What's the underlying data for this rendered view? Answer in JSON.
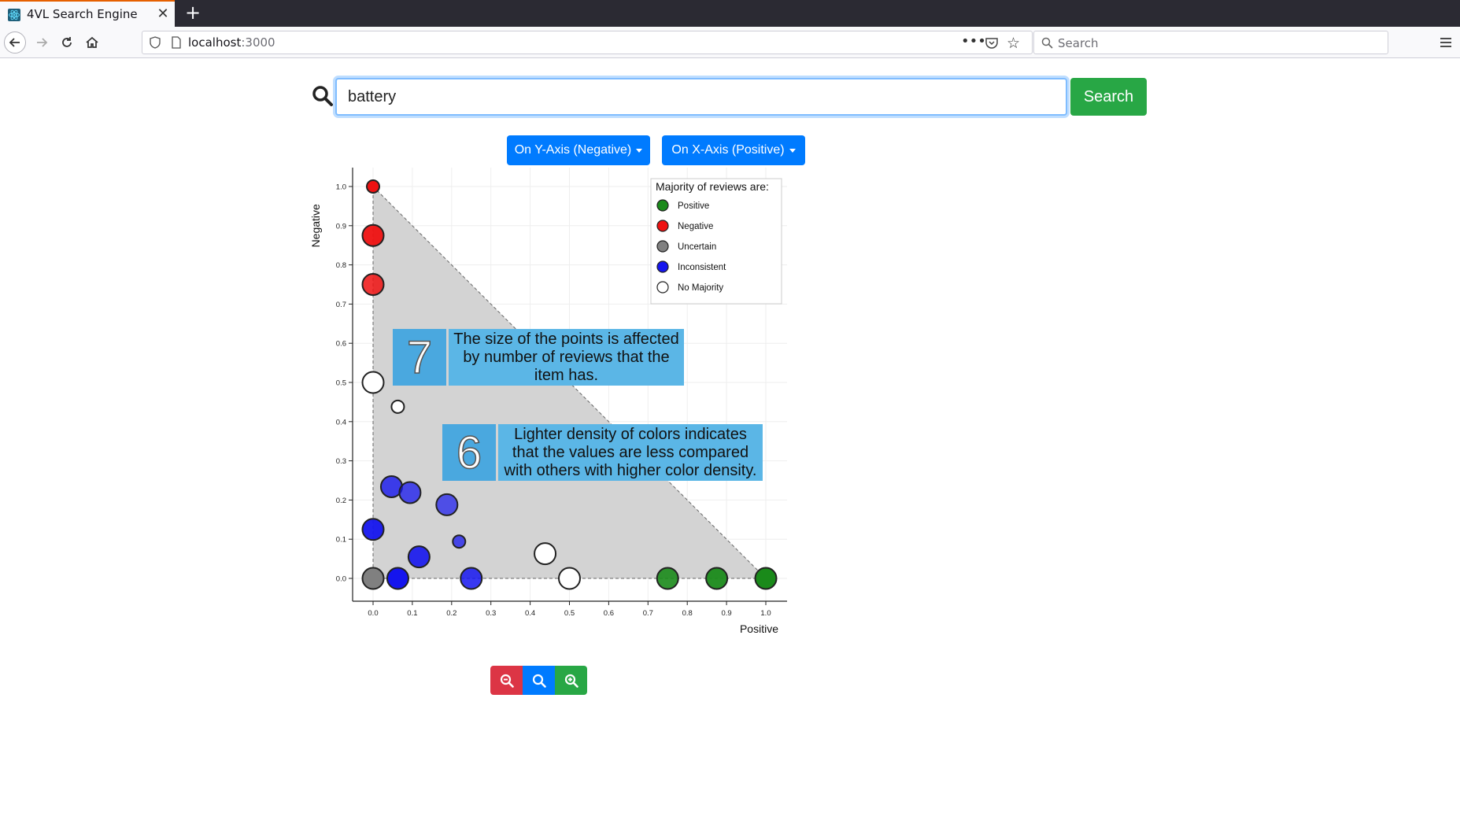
{
  "browser": {
    "tab_title": "4VL Search Engine",
    "url_host": "localhost",
    "url_port": ":3000",
    "search_placeholder": "Search"
  },
  "search": {
    "query": "battery",
    "button_label": "Search"
  },
  "dropdowns": {
    "y_axis_label": "On Y-Axis (Negative)",
    "x_axis_label": "On X-Axis (Positive)"
  },
  "legend": {
    "title": "Majority of reviews are:",
    "items": [
      {
        "label": "Positive",
        "color": "#1a8a1a"
      },
      {
        "label": "Negative",
        "color": "#ee1111"
      },
      {
        "label": "Uncertain",
        "color": "#808080"
      },
      {
        "label": "Inconsistent",
        "color": "#1515ee"
      },
      {
        "label": "No Majority",
        "color": "#ffffff"
      }
    ]
  },
  "callouts": [
    {
      "number": "7",
      "text": "The size of the points is affected by number of reviews that the item has."
    },
    {
      "number": "6",
      "text": "Lighter density of colors indicates that the values are less compared with others with higher color density."
    }
  ],
  "zoom": {
    "out_icon": "zoom-out-icon",
    "reset_icon": "search-icon",
    "in_icon": "zoom-in-icon"
  },
  "chart_data": {
    "type": "scatter",
    "xlabel": "Positive",
    "ylabel": "Negative",
    "xlim": [
      0,
      1
    ],
    "ylim": [
      0,
      1
    ],
    "x_ticks": [
      "0.0",
      "0.1",
      "0.2",
      "0.3",
      "0.4",
      "0.5",
      "0.6",
      "0.7",
      "0.8",
      "0.9",
      "1.0"
    ],
    "y_ticks": [
      "0.0",
      "0.1",
      "0.2",
      "0.3",
      "0.4",
      "0.5",
      "0.6",
      "0.7",
      "0.8",
      "0.9",
      "1.0"
    ],
    "grid": true,
    "legend_position": "top-right",
    "colors": {
      "positive": "#1a8a1a",
      "negative": "#ee1111",
      "uncertain": "#808080",
      "inconsistent": "#1515ee",
      "no_majority": "#ffffff"
    },
    "points": [
      {
        "x": 0.0,
        "y": 1.0,
        "category": "negative",
        "size": "small",
        "opacity": 1.0
      },
      {
        "x": 0.0,
        "y": 0.875,
        "category": "negative",
        "size": "medium",
        "opacity": 0.95
      },
      {
        "x": 0.0,
        "y": 0.75,
        "category": "negative",
        "size": "medium",
        "opacity": 0.85
      },
      {
        "x": 0.0,
        "y": 0.5,
        "category": "no_majority",
        "size": "medium",
        "opacity": 1.0
      },
      {
        "x": 0.063,
        "y": 0.438,
        "category": "no_majority",
        "size": "small",
        "opacity": 1.0
      },
      {
        "x": 0.047,
        "y": 0.234,
        "category": "inconsistent",
        "size": "medium",
        "opacity": 0.8
      },
      {
        "x": 0.094,
        "y": 0.219,
        "category": "inconsistent",
        "size": "medium",
        "opacity": 0.75
      },
      {
        "x": 0.188,
        "y": 0.188,
        "category": "inconsistent",
        "size": "medium",
        "opacity": 0.7
      },
      {
        "x": 0.0,
        "y": 0.125,
        "category": "inconsistent",
        "size": "medium",
        "opacity": 0.95
      },
      {
        "x": 0.219,
        "y": 0.094,
        "category": "inconsistent",
        "size": "small",
        "opacity": 0.75
      },
      {
        "x": 0.117,
        "y": 0.055,
        "category": "inconsistent",
        "size": "medium",
        "opacity": 0.9
      },
      {
        "x": 0.438,
        "y": 0.063,
        "category": "no_majority",
        "size": "medium",
        "opacity": 1.0
      },
      {
        "x": 0.0,
        "y": 0.0,
        "category": "uncertain",
        "size": "medium",
        "opacity": 1.0
      },
      {
        "x": 0.063,
        "y": 0.0,
        "category": "inconsistent",
        "size": "medium",
        "opacity": 1.0
      },
      {
        "x": 0.25,
        "y": 0.0,
        "category": "inconsistent",
        "size": "medium",
        "opacity": 0.85
      },
      {
        "x": 0.5,
        "y": 0.0,
        "category": "no_majority",
        "size": "medium",
        "opacity": 1.0
      },
      {
        "x": 0.75,
        "y": 0.0,
        "category": "positive",
        "size": "medium",
        "opacity": 0.9
      },
      {
        "x": 0.875,
        "y": 0.0,
        "category": "positive",
        "size": "medium",
        "opacity": 0.95
      },
      {
        "x": 1.0,
        "y": 0.0,
        "category": "positive",
        "size": "medium",
        "opacity": 1.0
      }
    ]
  }
}
